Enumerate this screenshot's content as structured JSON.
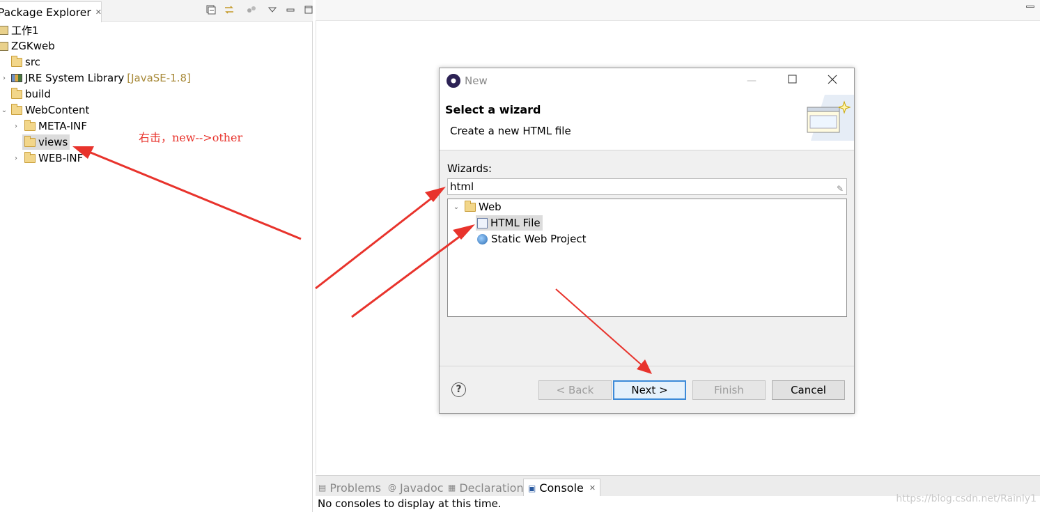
{
  "package_explorer": {
    "tab_label": "Package Explorer",
    "tab_close": "✕",
    "tree": [
      {
        "label": "工作1",
        "icon": "project-icon"
      },
      {
        "label": "ZGKweb",
        "icon": "project-icon"
      },
      {
        "label": "src",
        "icon": "package-folder-icon"
      },
      {
        "label": "JRE System Library",
        "decor": "[JavaSE-1.8]",
        "icon": "library-icon"
      },
      {
        "label": "build",
        "icon": "folder-icon"
      },
      {
        "label": "WebContent",
        "icon": "folder-icon"
      },
      {
        "label": "META-INF",
        "icon": "folder-icon"
      },
      {
        "label": "views",
        "icon": "folder-icon",
        "selected": true
      },
      {
        "label": "WEB-INF",
        "icon": "folder-icon"
      }
    ]
  },
  "annotation": "右击，new-->other",
  "dialog": {
    "title": "New",
    "heading": "Select a wizard",
    "description": "Create a new HTML file",
    "wizards_label": "Wizards:",
    "filter_value": "html",
    "tree": [
      {
        "label": "Web"
      },
      {
        "label": "HTML File",
        "selected": true
      },
      {
        "label": "Static Web Project"
      }
    ],
    "buttons": {
      "back": "< Back",
      "next": "Next >",
      "finish": "Finish",
      "cancel": "Cancel"
    },
    "help": "?"
  },
  "console": {
    "tabs": [
      {
        "label": "Problems"
      },
      {
        "label": "Javadoc"
      },
      {
        "label": "Declaration"
      },
      {
        "label": "Console",
        "active": true
      }
    ],
    "close": "✕",
    "message": "No consoles to display at this time."
  },
  "watermark": "https://blog.csdn.net/Rainly1",
  "colors": {
    "arrow": "#e8332c",
    "default_button_border": "#3c8ad8"
  }
}
